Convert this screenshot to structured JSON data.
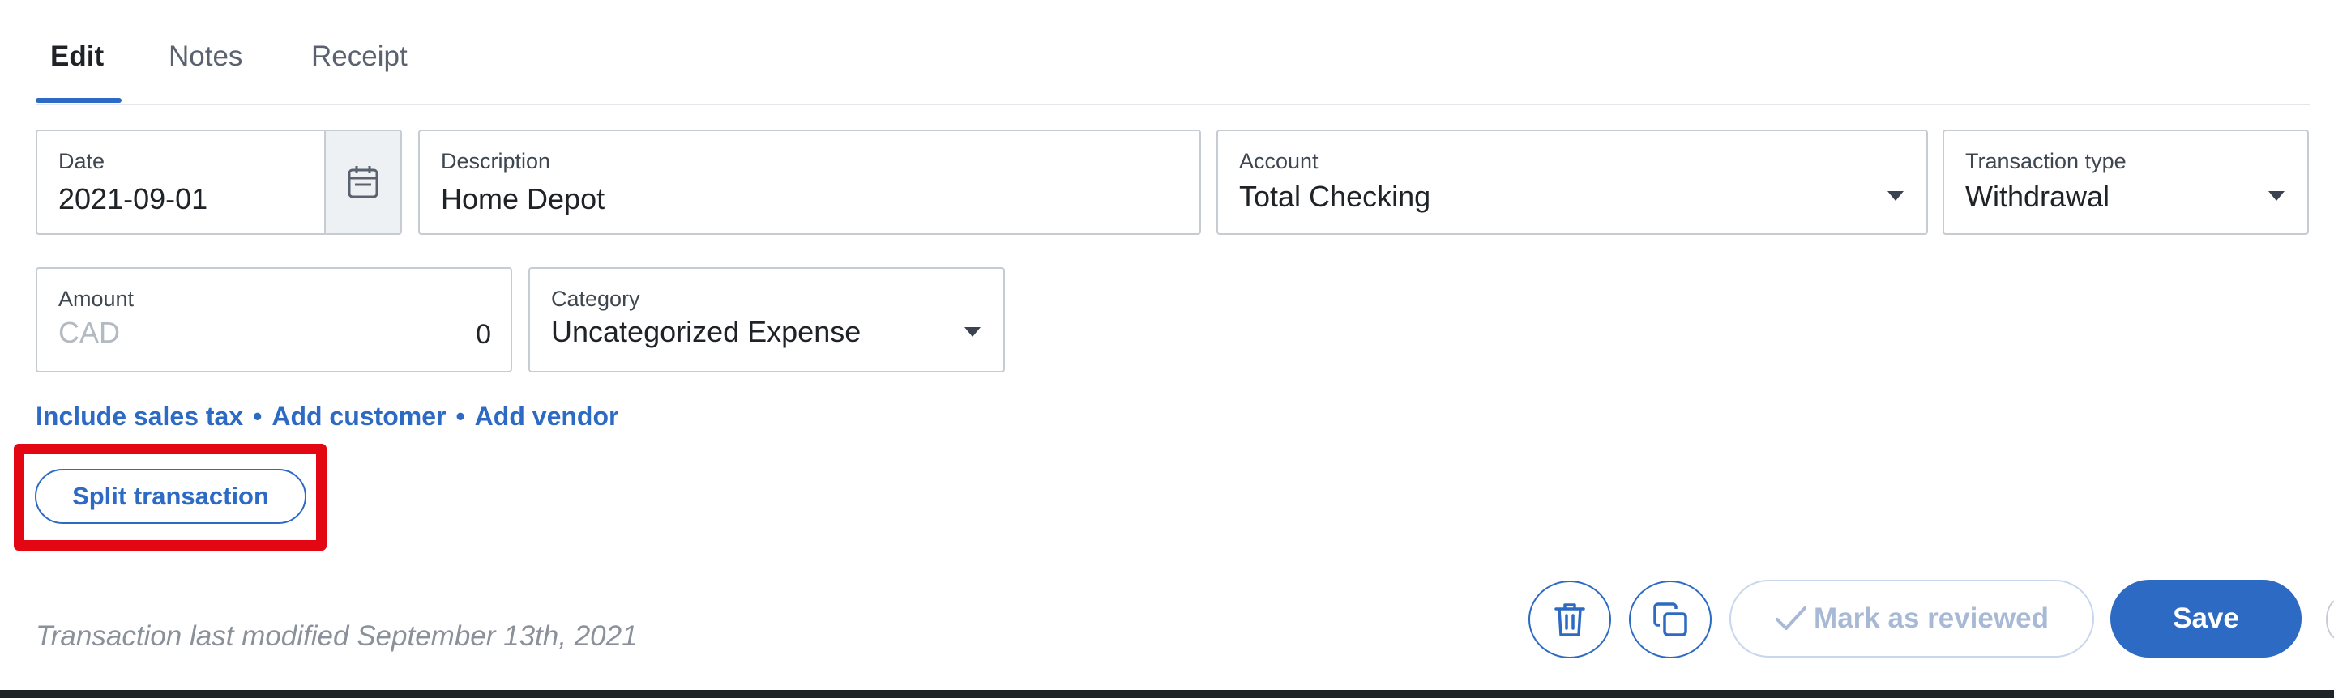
{
  "tabs": [
    {
      "label": "Edit",
      "active": true
    },
    {
      "label": "Notes",
      "active": false
    },
    {
      "label": "Receipt",
      "active": false
    }
  ],
  "fields": {
    "date": {
      "label": "Date",
      "value": "2021-09-01"
    },
    "description": {
      "label": "Description",
      "value": "Home Depot"
    },
    "account": {
      "label": "Account",
      "value": "Total Checking"
    },
    "transaction_type": {
      "label": "Transaction type",
      "value": "Withdrawal"
    },
    "amount": {
      "label": "Amount",
      "currency": "CAD",
      "value": "0"
    },
    "category": {
      "label": "Category",
      "value": "Uncategorized Expense"
    }
  },
  "links": {
    "sales_tax": "Include sales tax",
    "separator": "•",
    "customer": "Add customer",
    "vendor": "Add vendor"
  },
  "split_button": "Split transaction",
  "footer": {
    "modified_text": "Transaction last modified September 13th, 2021",
    "mark_reviewed": "Mark as reviewed",
    "save": "Save"
  },
  "colors": {
    "accent": "#2d6ac4",
    "highlight": "#e30613",
    "border": "#c7ccd3"
  }
}
